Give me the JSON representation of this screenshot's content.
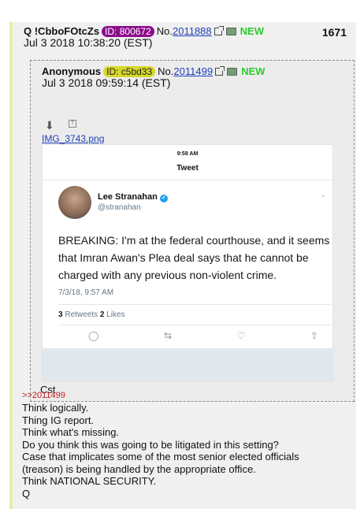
{
  "post": {
    "tripcode": "Q !CbboFOtcZs",
    "id_badge": "ID: 800672",
    "no_prefix": "No.",
    "post_no": "2011888",
    "new_label": "NEW",
    "count": "1671",
    "datetime": "Jul 3 2018 10:38:20 (EST)"
  },
  "quoted": {
    "name": "Anonymous",
    "id_badge": "ID: c5bd33",
    "no_prefix": "No.",
    "post_no": "2011499",
    "new_label": "NEW",
    "datetime": "Jul 3 2018 09:59:14 (EST)",
    "filename": "IMG_3743.png",
    "caption": "Cst",
    "tweet": {
      "time": "9:58 AM",
      "title": "Tweet",
      "name": "Lee Stranahan",
      "handle": "@stranahan",
      "text": "BREAKING: I'm at the federal courthouse, and it seems that Imran Awan's Plea deal says that he cannot be charged with any previous non-violent crime.",
      "date": "7/3/18, 9:57 AM",
      "retweets_count": "3",
      "retweets_label": "Retweets",
      "likes_count": "2",
      "likes_label": "Likes"
    }
  },
  "reply": {
    "link": ">>2011499",
    "lines": [
      "Think logically.",
      "Thing IG report.",
      "Think what's missing.",
      "Do you think this was going to be litigated in this setting?",
      "Case that implicates some of the most senior elected officials",
      "(treason) is being handled by the appropriate office.",
      "Think NATIONAL SECURITY.",
      "Q"
    ]
  },
  "colors": {
    "id_q": "#8b0c8b",
    "id_anon": "#d8d82a",
    "new": "#2ecc2e",
    "link": "#1f3fb8",
    "reply_link": "#c41e1e",
    "verified": "#1da1f2"
  },
  "icons": [
    "external-link-icon",
    "archive-book-icon",
    "download-icon",
    "text-file-icon",
    "verified-badge-icon",
    "chevron-down-icon",
    "reply-icon",
    "retweet-icon",
    "like-icon",
    "share-icon"
  ]
}
